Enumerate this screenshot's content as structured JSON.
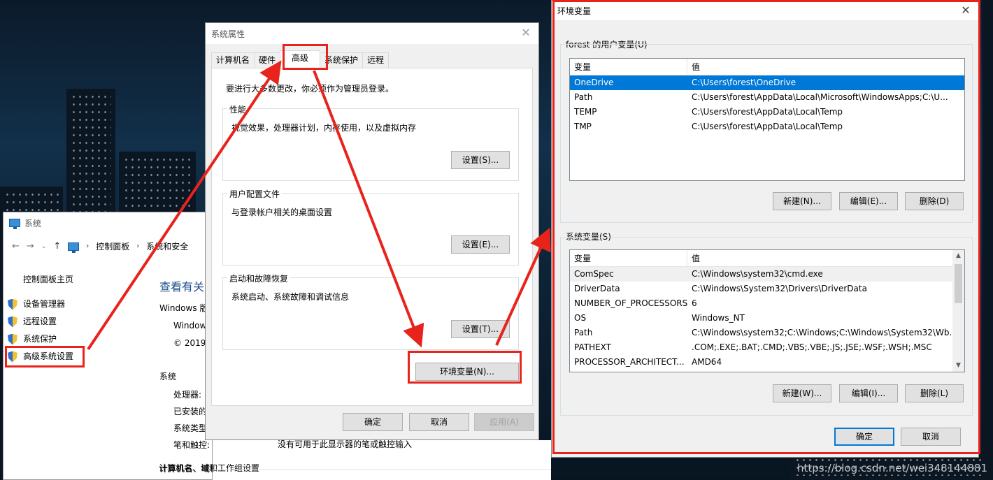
{
  "watermark": "https://blog.csdn.net/wei348144881",
  "system_window": {
    "title": "系统",
    "breadcrumb": [
      "控制面板",
      "系统和安全"
    ],
    "sidebar_home": "控制面板主页",
    "sidebar_items": [
      "设备管理器",
      "远程设置",
      "系统保护",
      "高级系统设置"
    ],
    "heading": "查看有关",
    "win_edition_label": "Windows 版",
    "win_name": "Window",
    "copyright": "© 2019",
    "section_system": "系统",
    "rows": [
      {
        "label": "处理器:",
        "value": ""
      },
      {
        "label": "已安装的",
        "value": ""
      },
      {
        "label": "系统类型",
        "value": ""
      },
      {
        "label": "笔和触控:",
        "value": "没有可用于此显示器的笔或触控输入"
      }
    ],
    "section_computer": "计算机名、域和工作组设置"
  },
  "props_dialog": {
    "title": "系统属性",
    "tabs": [
      "计算机名",
      "硬件",
      "高级",
      "系统保护",
      "远程"
    ],
    "active_tab": 2,
    "admin_note": "要进行大多数更改，你必须作为管理员登录。",
    "groups": [
      {
        "label": "性能",
        "desc": "视觉效果，处理器计划，内存使用，以及虚拟内存",
        "button": "设置(S)..."
      },
      {
        "label": "用户配置文件",
        "desc": "与登录帐户相关的桌面设置",
        "button": "设置(E)..."
      },
      {
        "label": "启动和故障恢复",
        "desc": "系统启动、系统故障和调试信息",
        "button": "设置(T)..."
      }
    ],
    "env_button": "环境变量(N)...",
    "ok": "确定",
    "cancel": "取消",
    "apply": "应用(A)"
  },
  "env_dialog": {
    "title": "环境变量",
    "user_section": "forest 的用户变量(U)",
    "col_var": "变量",
    "col_val": "值",
    "user_vars": [
      {
        "name": "OneDrive",
        "value": "C:\\Users\\forest\\OneDrive"
      },
      {
        "name": "Path",
        "value": "C:\\Users\\forest\\AppData\\Local\\Microsoft\\WindowsApps;C:\\U..."
      },
      {
        "name": "TEMP",
        "value": "C:\\Users\\forest\\AppData\\Local\\Temp"
      },
      {
        "name": "TMP",
        "value": "C:\\Users\\forest\\AppData\\Local\\Temp"
      }
    ],
    "user_buttons": {
      "new": "新建(N)...",
      "edit": "编辑(E)...",
      "delete": "删除(D)"
    },
    "system_section": "系统变量(S)",
    "system_vars": [
      {
        "name": "ComSpec",
        "value": "C:\\Windows\\system32\\cmd.exe"
      },
      {
        "name": "DriverData",
        "value": "C:\\Windows\\System32\\Drivers\\DriverData"
      },
      {
        "name": "NUMBER_OF_PROCESSORS",
        "value": "6"
      },
      {
        "name": "OS",
        "value": "Windows_NT"
      },
      {
        "name": "Path",
        "value": "C:\\Windows\\system32;C:\\Windows;C:\\Windows\\System32\\Wb..."
      },
      {
        "name": "PATHEXT",
        "value": ".COM;.EXE;.BAT;.CMD;.VBS;.VBE;.JS;.JSE;.WSF;.WSH;.MSC"
      },
      {
        "name": "PROCESSOR_ARCHITECT...",
        "value": "AMD64"
      }
    ],
    "system_buttons": {
      "new": "新建(W)...",
      "edit": "编辑(I)...",
      "delete": "删除(L)"
    },
    "ok": "确定",
    "cancel": "取消"
  },
  "annotation_color": "#e8231c"
}
